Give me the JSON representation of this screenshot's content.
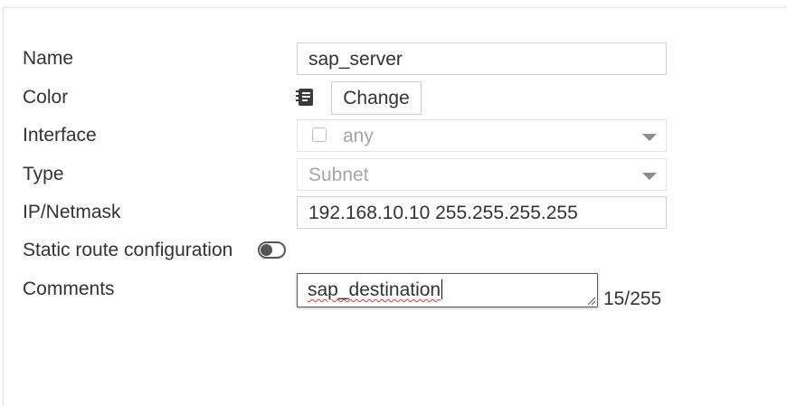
{
  "form": {
    "name": {
      "label": "Name",
      "value": "sap_server"
    },
    "color": {
      "label": "Color",
      "icon": "color-swatch-icon",
      "change_label": "Change"
    },
    "interface": {
      "label": "Interface",
      "value": "any",
      "disabled": true
    },
    "type": {
      "label": "Type",
      "value": "Subnet",
      "disabled": true
    },
    "ip_netmask": {
      "label": "IP/Netmask",
      "value": "192.168.10.10 255.255.255.255"
    },
    "static_route": {
      "label": "Static route configuration",
      "enabled": false
    },
    "comments": {
      "label": "Comments",
      "value": "sap_destination",
      "counter": "15/255"
    }
  },
  "colors": {
    "text": "#333333",
    "disabled_text": "#a6a6a6",
    "border": "#cfcfcf",
    "spellcheck": "#d33a3a"
  }
}
